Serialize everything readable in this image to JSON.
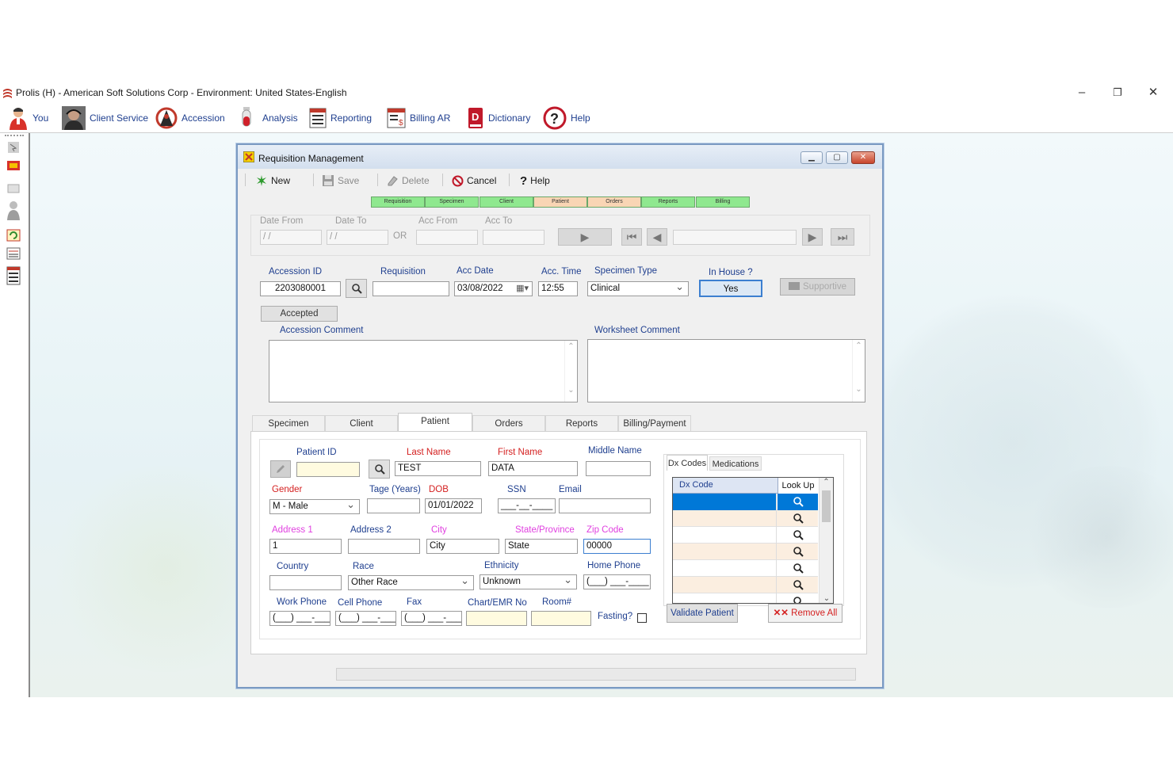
{
  "titlebar": {
    "title": "Prolis (H) - American Soft Solutions Corp - Environment: United States-English",
    "minimize": "–",
    "restore": "❐",
    "close": "✕"
  },
  "menu": [
    {
      "label": "You",
      "icon": "user-icon"
    },
    {
      "label": "Client Service",
      "icon": "client-service-icon"
    },
    {
      "label": "Accession",
      "icon": "accession-icon"
    },
    {
      "label": "Analysis",
      "icon": "test-tube-icon"
    },
    {
      "label": "Reporting",
      "icon": "report-icon"
    },
    {
      "label": "Billing AR",
      "icon": "billing-icon"
    },
    {
      "label": "Dictionary",
      "icon": "dictionary-icon"
    },
    {
      "label": "Help",
      "icon": "help-icon"
    }
  ],
  "window": {
    "title": "Requisition Management",
    "toolbar": {
      "new": "New",
      "save": "Save",
      "delete": "Delete",
      "cancel": "Cancel",
      "help": "Help"
    },
    "steps": [
      {
        "label": "Requisition",
        "color": "#8fe88f"
      },
      {
        "label": "Specimen",
        "color": "#8fe88f"
      },
      {
        "label": "Client",
        "color": "#8fe88f"
      },
      {
        "label": "Patient",
        "color": "#f9d5b4"
      },
      {
        "label": "Orders",
        "color": "#f9d5b4"
      },
      {
        "label": "Reports",
        "color": "#8fe88f"
      },
      {
        "label": "Billing",
        "color": "#8fe88f"
      }
    ],
    "search": {
      "date_from_label": "Date From",
      "date_from_value": " / /",
      "date_to_label": "Date To",
      "date_to_value": " / /",
      "or_label": "OR",
      "acc_from_label": "Acc From",
      "acc_to_label": "Acc To"
    },
    "accession": {
      "accession_id_label": "Accession ID",
      "accession_id_value": "2203080001",
      "requisition_label": "Requisition",
      "requisition_value": "",
      "acc_date_label": "Acc Date",
      "acc_date_value": "03/08/2022",
      "acc_time_label": "Acc. Time",
      "acc_time_value": "12:55",
      "specimen_type_label": "Specimen Type",
      "specimen_type_value": "Clinical",
      "in_house_label": "In House ?",
      "in_house_value": "Yes",
      "supportive_label": "Supportive",
      "status_value": "Accepted",
      "accession_comment_label": "Accession Comment",
      "worksheet_comment_label": "Worksheet Comment"
    },
    "tabs": [
      "Specimen",
      "Client",
      "Patient",
      "Orders",
      "Reports",
      "Billing/Payment"
    ],
    "active_tab": "Patient",
    "patient": {
      "patient_id_label": "Patient ID",
      "patient_id_value": "",
      "last_name_label": "Last Name",
      "last_name_value": "TEST",
      "first_name_label": "First Name",
      "first_name_value": "DATA",
      "middle_name_label": "Middle Name",
      "middle_name_value": "",
      "gender_label": "Gender",
      "gender_value": "M - Male",
      "tage_label": "Tage (Years)",
      "tage_value": "",
      "dob_label": "DOB",
      "dob_value": "01/01/2022",
      "ssn_label": "SSN",
      "ssn_value": "___-__-____",
      "email_label": "Email",
      "email_value": "",
      "address1_label": "Address 1",
      "address1_value": "1",
      "address2_label": "Address 2",
      "address2_value": "",
      "city_label": "City",
      "city_value": "City",
      "state_label": "State/Province",
      "state_value": "State",
      "zip_label": "Zip Code",
      "zip_value": "00000",
      "country_label": "Country",
      "country_value": "",
      "race_label": "Race",
      "race_value": "Other Race",
      "ethnicity_label": "Ethnicity",
      "ethnicity_value": "Unknown",
      "home_phone_label": "Home Phone",
      "home_phone_value": "(___) ___-____",
      "work_phone_label": "Work Phone",
      "work_phone_value": "(___) ___-____",
      "cell_phone_label": "Cell Phone",
      "cell_phone_value": "(___) ___-____",
      "fax_label": "Fax",
      "fax_value": "(___) ___-____",
      "chart_label": "Chart/EMR No",
      "chart_value": "",
      "room_label": "Room#",
      "room_value": "",
      "fasting_label": "Fasting?",
      "validate_label": "Validate Patient",
      "remove_all_label": "Remove All"
    },
    "dx": {
      "tabs": [
        "Dx Codes",
        "Medications"
      ],
      "col_code": "Dx Code",
      "col_lookup": "Look Up",
      "rows": 7
    }
  },
  "colors": {
    "label_blue": "#1f3f8f",
    "required_red": "#d42020",
    "magenta": "#e040e0",
    "selection": "#0078d7",
    "row_alt": "#fbeee0"
  }
}
